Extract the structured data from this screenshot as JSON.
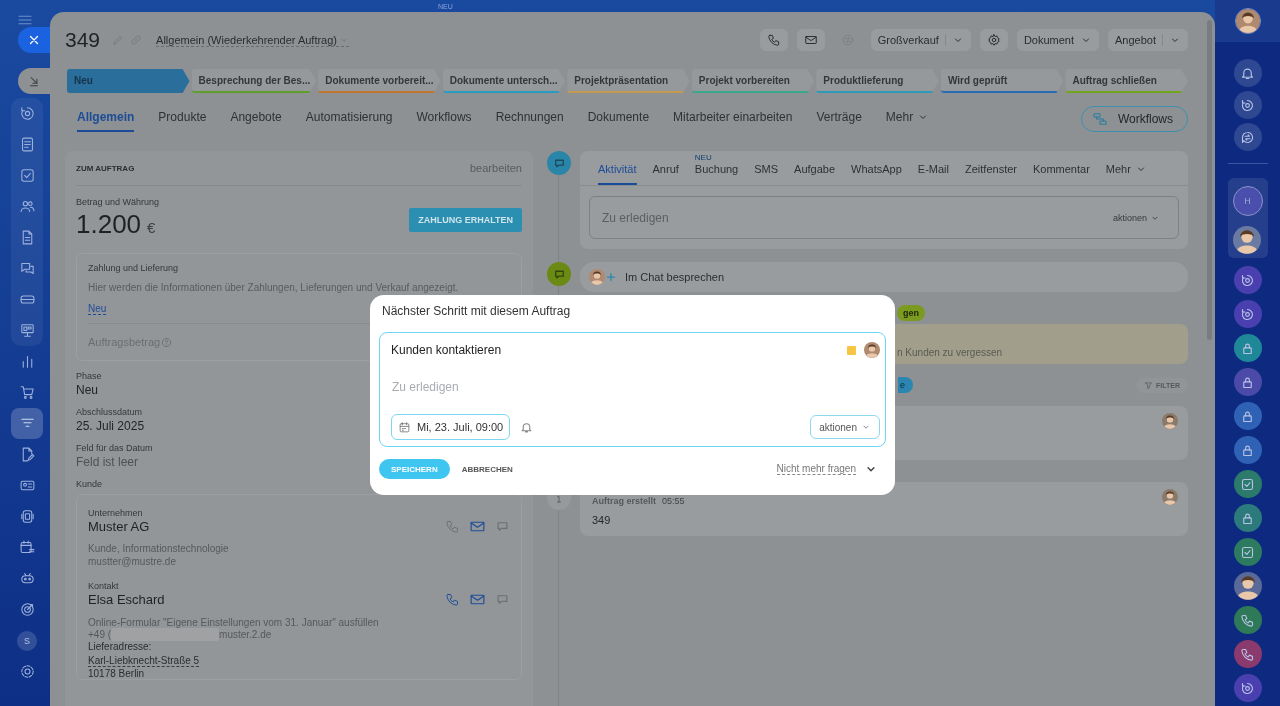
{
  "top_badge": "NEU",
  "nav": {
    "group": [
      {
        "kind": "cycle",
        "selected": false
      },
      {
        "kind": "doclist",
        "selected": false
      },
      {
        "kind": "check",
        "selected": false
      },
      {
        "kind": "people",
        "selected": false
      },
      {
        "kind": "doc",
        "selected": false
      },
      {
        "kind": "chat",
        "selected": false
      },
      {
        "kind": "card",
        "selected": false
      },
      {
        "kind": "board",
        "selected": false
      }
    ],
    "items": [
      {
        "kind": "chart",
        "selected": false
      },
      {
        "kind": "cart",
        "selected": false
      },
      {
        "kind": "funnel",
        "selected": true
      },
      {
        "kind": "docedit",
        "selected": false
      },
      {
        "kind": "idcard",
        "selected": false
      },
      {
        "kind": "widget",
        "selected": false
      },
      {
        "kind": "callist",
        "selected": false
      },
      {
        "kind": "robot",
        "selected": false
      },
      {
        "kind": "target",
        "selected": false
      },
      {
        "kind": "letter",
        "label": "S",
        "selected": false
      },
      {
        "kind": "flower",
        "selected": false
      }
    ]
  },
  "header": {
    "number": "349",
    "category": "Allgemein (Wiederkehrender Auftrag)",
    "toolbar": [
      {
        "kind": "phone",
        "disabled": false
      },
      {
        "kind": "mail",
        "disabled": false
      },
      {
        "kind": "sync",
        "disabled": true
      },
      {
        "kind": "split",
        "label": "Großverkauf"
      },
      {
        "kind": "gear",
        "disabled": false
      },
      {
        "kind": "dropdown",
        "label": "Dokument"
      },
      {
        "kind": "split",
        "label": "Angebot"
      }
    ]
  },
  "stages": [
    {
      "label": "Neu",
      "color": "#2a6e9c",
      "selected": true
    },
    {
      "label": "Besprechung der Bes...",
      "color": "#5f9e2a",
      "selected": false
    },
    {
      "label": "Dokumente vorbereit...",
      "color": "#c0762c",
      "selected": false
    },
    {
      "label": "Dokumente untersch...",
      "color": "#2a9cc0",
      "selected": false
    },
    {
      "label": "Projektpräsentation",
      "color": "#c49a50",
      "selected": false
    },
    {
      "label": "Projekt vorbereiten",
      "color": "#3aa88a",
      "selected": false
    },
    {
      "label": "Produktlieferung",
      "color": "#2c9ab6",
      "selected": false
    },
    {
      "label": "Wird geprüft",
      "color": "#2a6cb4",
      "selected": false
    },
    {
      "label": "Auftrag schließen",
      "color": "#74a51e",
      "selected": false
    }
  ],
  "tabs": [
    {
      "label": "Allgemein",
      "selected": true
    },
    {
      "label": "Produkte",
      "selected": false
    },
    {
      "label": "Angebote",
      "selected": false
    },
    {
      "label": "Automatisierung",
      "selected": false
    },
    {
      "label": "Workflows",
      "selected": false
    },
    {
      "label": "Rechnungen",
      "selected": false
    },
    {
      "label": "Dokumente",
      "selected": false
    },
    {
      "label": "Mitarbeiter einarbeiten",
      "selected": false
    },
    {
      "label": "Verträge",
      "selected": false
    },
    {
      "label": "Mehr",
      "selected": false
    }
  ],
  "workflows_button": "Workflows",
  "details": {
    "title": "ZUM AUFTRAG",
    "edit": "bearbeiten",
    "amount_label": "Betrag und Währung",
    "amount": "1.200",
    "currency": "€",
    "pay_button": "ZAHLUNG ERHALTEN",
    "payment": {
      "title": "Zahlung und Lieferung",
      "text": "Hier werden die Informationen über Zahlungen, Lieferungen und Verkauf angezeigt.",
      "link": "Neu",
      "amount_label": "Auftragsbetrag"
    },
    "fields": [
      {
        "label": "Phase",
        "value": "Neu",
        "empty": false
      },
      {
        "label": "Abschlussdatum",
        "value": "25. Juli 2025",
        "empty": false
      },
      {
        "label": "Feld für das Datum",
        "value": "Feld ist leer",
        "empty": true
      }
    ],
    "client_label": "Kunde",
    "company": {
      "label": "Unternehmen",
      "name": "Muster AG",
      "lines": [
        "Kunde, Informationstechnologie",
        "mustter@mustre.de"
      ],
      "phone_active": false
    },
    "contact": {
      "label": "Kontakt",
      "name": "Elsa Eschard",
      "phone_active": true,
      "note": "Online-Formular \"Eigene Einstellungen vom 31. Januar\" ausfüllen",
      "phone_start": "+49 (",
      "email_end": "muster.2.de",
      "address_label": "Lieferadresse:",
      "street": "Karl-Liebknecht-Straße 5",
      "city": "10178 Berlin"
    }
  },
  "activity": {
    "tabs": [
      {
        "label": "Aktivität",
        "selected": true
      },
      {
        "label": "Anruf",
        "selected": false
      },
      {
        "label": "Buchung",
        "badge": "NEU",
        "selected": false
      },
      {
        "label": "SMS",
        "selected": false
      },
      {
        "label": "Aufgabe",
        "selected": false
      },
      {
        "label": "WhatsApp",
        "selected": false
      },
      {
        "label": "E-Mail",
        "selected": false
      },
      {
        "label": "Zeitfenster",
        "selected": false
      },
      {
        "label": "Kommentar",
        "selected": false
      },
      {
        "label": "Mehr",
        "selected": false
      }
    ],
    "placeholder": "Zu erledigen",
    "actions": "aktionen"
  },
  "chat": "Im Chat besprechen",
  "green_pill": "gen",
  "notice": "n Kunden zu vergessen",
  "blue_pill": "e",
  "filter": "FILTER",
  "event": {
    "title": "Auftrag erstellt",
    "time": "05:55",
    "text": "349"
  },
  "modal": {
    "title": "Nächster Schritt mit diesem Auftrag",
    "task": "Kunden kontaktieren",
    "placeholder": "Zu erledigen",
    "date": "Mi, 23. Juli, 09:00",
    "actions": "aktionen",
    "save": "SPEICHERN",
    "cancel": "ABBRECHEN",
    "dont_ask": "Nicht mehr fragen"
  },
  "right_bar": {
    "top": [
      {
        "kind": "bell"
      },
      {
        "kind": "cycle"
      },
      {
        "kind": "chatswap"
      }
    ],
    "group": [
      {
        "kind": "letter",
        "label": "H"
      },
      {
        "kind": "person"
      }
    ],
    "apps": [
      {
        "kind": "cycle",
        "color": "#4a3fae"
      },
      {
        "kind": "cycle",
        "color": "#4a3fae"
      },
      {
        "kind": "lock",
        "color": "#1f8898"
      },
      {
        "kind": "lock",
        "color": "#4b4aa8"
      },
      {
        "kind": "lock",
        "color": "#2f62b4"
      },
      {
        "kind": "lock",
        "color": "#2f62b4"
      },
      {
        "kind": "check",
        "color": "#2c7a6c"
      },
      {
        "kind": "lock",
        "color": "#2c7a7c"
      },
      {
        "kind": "check",
        "color": "#2c7a60"
      },
      {
        "kind": "person",
        "color": "#5a6a98"
      },
      {
        "kind": "phone",
        "color": "#2e7a58"
      },
      {
        "kind": "phone",
        "color": "#8a3a6c"
      },
      {
        "kind": "cycle",
        "color": "#4a3fae"
      }
    ]
  }
}
